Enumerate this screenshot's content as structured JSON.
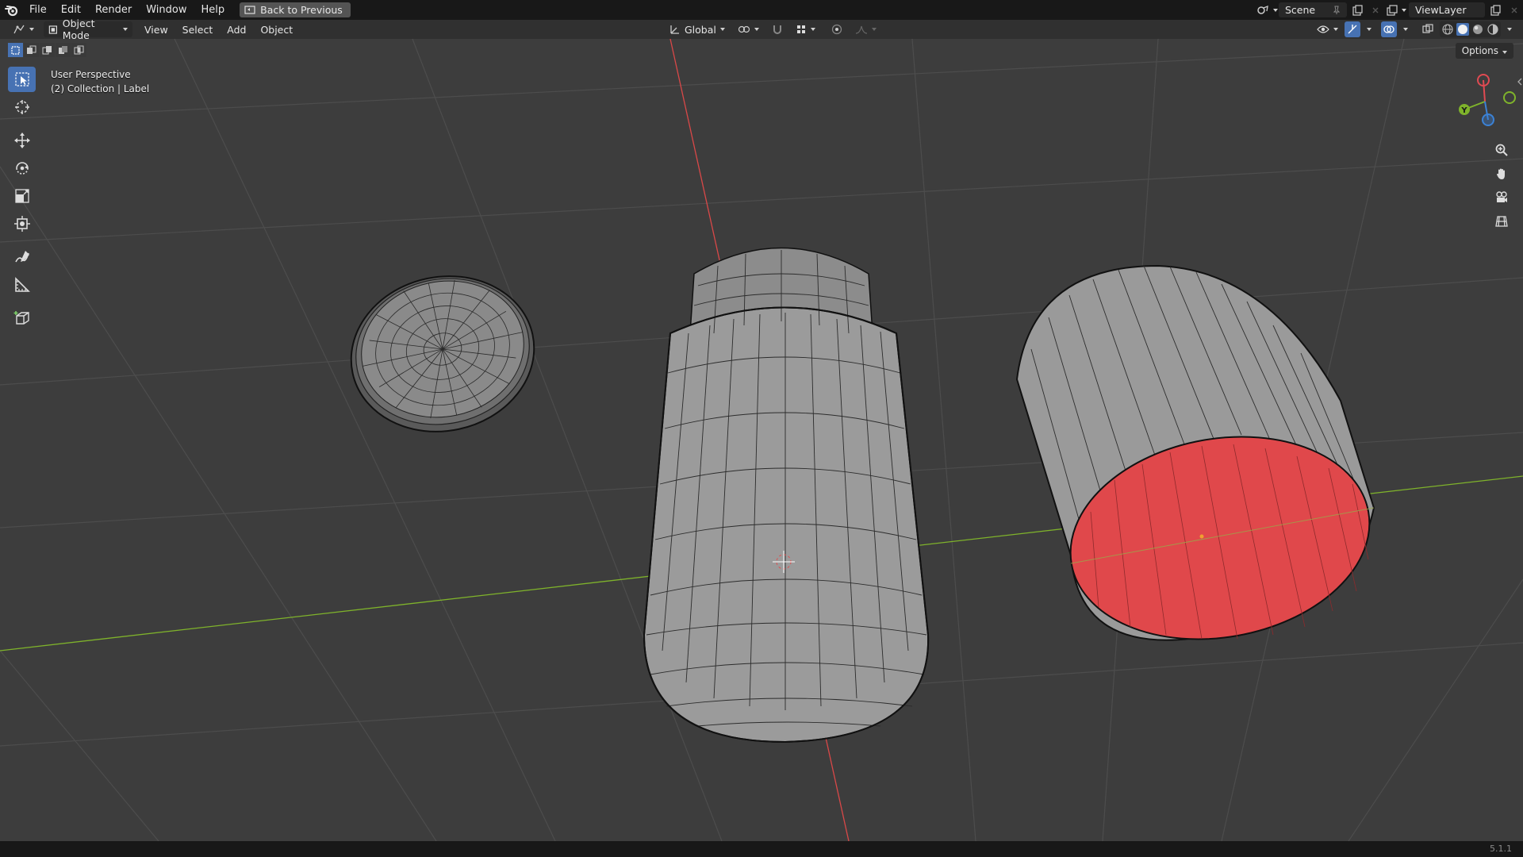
{
  "app": {
    "version": "5.1.1"
  },
  "topbar": {
    "menus": [
      "File",
      "Edit",
      "Render",
      "Window",
      "Help"
    ],
    "back_button": "Back to Previous",
    "scene": "Scene",
    "view_layer": "ViewLayer"
  },
  "header": {
    "mode": "Object Mode",
    "menus": [
      "View",
      "Select",
      "Add",
      "Object"
    ],
    "transform_orientation": "Global",
    "options": "Options"
  },
  "viewport": {
    "perspective": "User Perspective",
    "collection_info": "(2) Collection | Label"
  },
  "toolbar": {
    "tools": [
      "select-box-icon",
      "cursor-icon",
      "move-icon",
      "rotate-icon",
      "scale-icon",
      "transform-icon",
      "annotate-icon",
      "measure-icon",
      "add-cube-icon"
    ]
  },
  "gizmo": {
    "labels": [
      "Y"
    ]
  },
  "colors": {
    "accent": "#4772b3",
    "x_axis": "#e04a52",
    "y_axis": "#7fb32b",
    "z_axis": "#3b82d6",
    "selected_face": "#e0484b"
  }
}
